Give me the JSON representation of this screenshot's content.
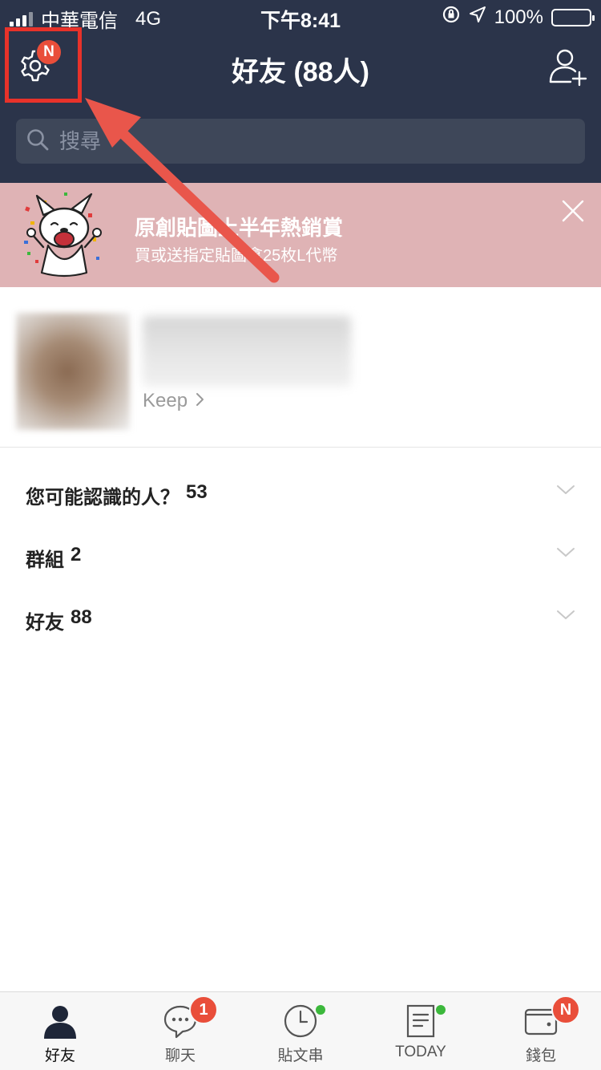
{
  "status_bar": {
    "carrier": "中華電信",
    "network": "4G",
    "time": "下午8:41",
    "battery": "100%"
  },
  "header": {
    "title": "好友 (88人)",
    "settings_badge": "N"
  },
  "search": {
    "placeholder": "搜尋"
  },
  "banner": {
    "title": "原創貼圖上半年熱銷賞",
    "subtitle": "買或送指定貼圖拿25枚L代幣"
  },
  "profile": {
    "keep_label": "Keep"
  },
  "sections": [
    {
      "label": "您可能認識的人？",
      "count": "53"
    },
    {
      "label": "群組",
      "count": "2"
    },
    {
      "label": "好友",
      "count": "88"
    }
  ],
  "tabs": [
    {
      "label": "好友",
      "icon": "friends-icon",
      "active": true
    },
    {
      "label": "聊天",
      "icon": "chat-icon",
      "badge": "1"
    },
    {
      "label": "貼文串",
      "icon": "timeline-clock-icon",
      "dot": true
    },
    {
      "label": "TODAY",
      "icon": "today-news-icon",
      "dot": true
    },
    {
      "label": "錢包",
      "icon": "wallet-icon",
      "badge": "N"
    }
  ],
  "colors": {
    "header_bg": "#2b344a",
    "banner_bg": "#dfb3b5",
    "highlight": "#e8322a",
    "badge": "#e94e3a",
    "online_dot": "#3cb83c"
  }
}
